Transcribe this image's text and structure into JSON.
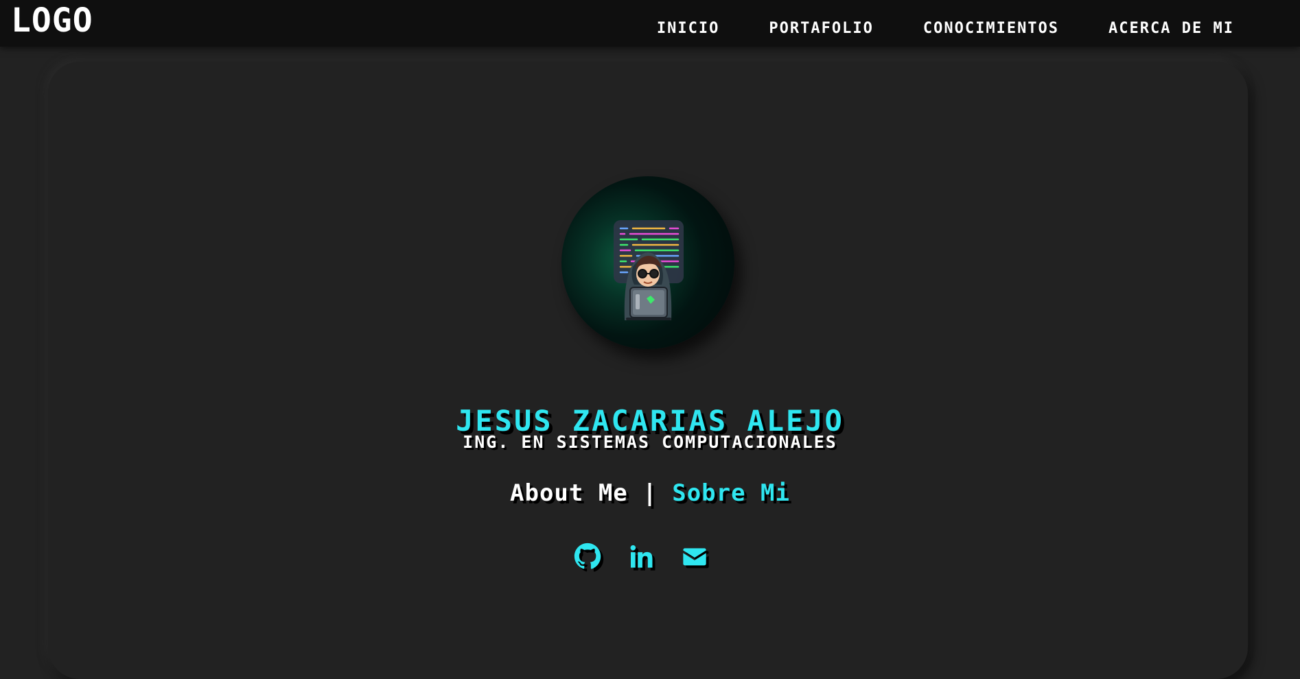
{
  "header": {
    "logo": "LOGO",
    "nav": [
      {
        "label": "INICIO"
      },
      {
        "label": "PORTAFOLIO"
      },
      {
        "label": "CONOCIMIENTOS"
      },
      {
        "label": "ACERCA DE MI"
      }
    ]
  },
  "profile": {
    "name": "JESUS ZACARIAS ALEJO",
    "subtitle": "ING. EN SISTEMAS COMPUTACIONALES",
    "about_en": "About Me",
    "about_sep": "|",
    "about_es": "Sobre Mi"
  },
  "socials": [
    {
      "icon": "github-icon"
    },
    {
      "icon": "linkedin-icon"
    },
    {
      "icon": "envelope-icon"
    }
  ],
  "colors": {
    "accent": "#2fe6f0",
    "background": "#222222",
    "navbar": "#0f0f0f",
    "text": "#ffffff"
  }
}
